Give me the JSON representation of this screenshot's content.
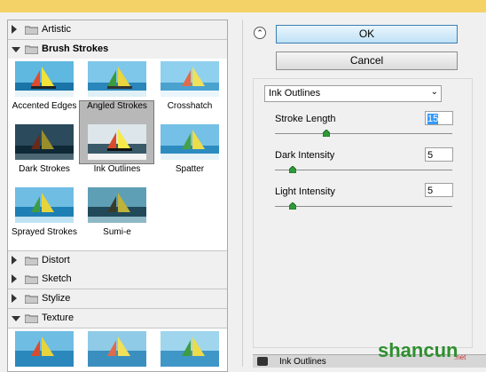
{
  "filter_categories": {
    "artistic": {
      "label": "Artistic",
      "expanded": false
    },
    "brush_strokes": {
      "label": "Brush Strokes",
      "expanded": true
    },
    "distort": {
      "label": "Distort",
      "expanded": false
    },
    "sketch": {
      "label": "Sketch",
      "expanded": false
    },
    "stylize": {
      "label": "Stylize",
      "expanded": false
    },
    "texture": {
      "label": "Texture",
      "expanded": true
    }
  },
  "brush_strokes_filters": [
    {
      "label": "Accented Edges"
    },
    {
      "label": "Angled Strokes"
    },
    {
      "label": "Crosshatch"
    },
    {
      "label": "Dark Strokes"
    },
    {
      "label": "Ink Outlines",
      "selected": true
    },
    {
      "label": "Spatter"
    },
    {
      "label": "Sprayed Strokes"
    },
    {
      "label": "Sumi-e"
    }
  ],
  "buttons": {
    "ok": "OK",
    "cancel": "Cancel"
  },
  "filter_select": {
    "value": "Ink Outlines"
  },
  "params": {
    "stroke_length": {
      "label": "Stroke Length",
      "value": "15",
      "slider_fraction": 0.29
    },
    "dark_intensity": {
      "label": "Dark Intensity",
      "value": "5",
      "slider_fraction": 0.1
    },
    "light_intensity": {
      "label": "Light Intensity",
      "value": "5",
      "slider_fraction": 0.1
    }
  },
  "layer_bar": {
    "label": "Ink Outlines"
  },
  "watermark": {
    "brand": "shancun",
    "domain": ".net"
  },
  "colors": {
    "topbar": "#f4d267",
    "accent": "#3399ff",
    "watermark_green": "#2f8f2f"
  },
  "icons": {
    "collapse": "double-chevron-up-icon",
    "expand": "triangle-right-icon",
    "expanded": "triangle-down-icon",
    "folder": "folder-icon",
    "dropdown": "chevron-down-icon",
    "slider": "slider-knob-icon",
    "visibility": "eye-icon"
  }
}
